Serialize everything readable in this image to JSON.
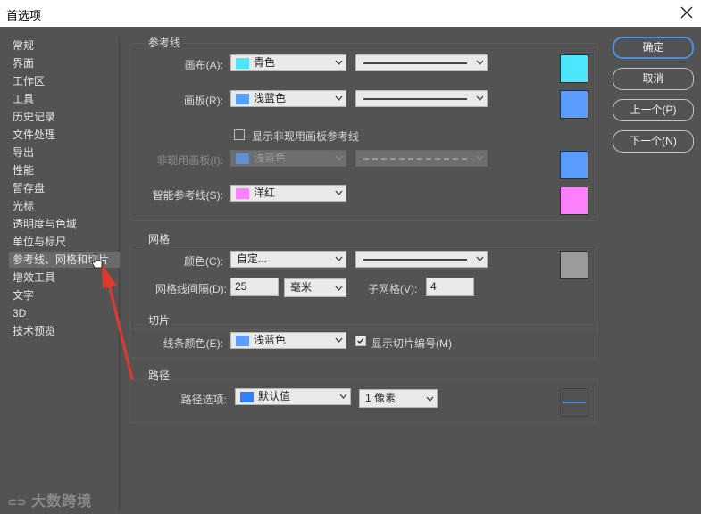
{
  "window": {
    "title": "首选项"
  },
  "sidebar": {
    "items": [
      {
        "label": "常规"
      },
      {
        "label": "界面"
      },
      {
        "label": "工作区"
      },
      {
        "label": "工具"
      },
      {
        "label": "历史记录"
      },
      {
        "label": "文件处理"
      },
      {
        "label": "导出"
      },
      {
        "label": "性能"
      },
      {
        "label": "暂存盘"
      },
      {
        "label": "光标"
      },
      {
        "label": "透明度与色域"
      },
      {
        "label": "单位与标尺"
      },
      {
        "label": "参考线、网格和切片"
      },
      {
        "label": "增效工具"
      },
      {
        "label": "文字"
      },
      {
        "label": "3D"
      },
      {
        "label": "技术预览"
      }
    ],
    "selected_index": 12
  },
  "guides": {
    "title": "参考线",
    "canvas": {
      "label": "画布(A):",
      "color_name": "青色",
      "swatch": "#4ee6ff"
    },
    "artboard": {
      "label": "画板(R):",
      "color_name": "浅蓝色",
      "swatch": "#5a9cff"
    },
    "show_inactive": {
      "label": "显示非现用画板参考线",
      "checked": false
    },
    "inactive_artboard": {
      "label": "非现用画板(I):",
      "color_name": "浅蓝色",
      "swatch": "#5a9cff"
    },
    "smart_guides": {
      "label": "智能参考线(S):",
      "color_name": "洋红",
      "swatch": "#ff80ff"
    }
  },
  "grid": {
    "title": "网格",
    "color": {
      "label": "颜色(C):",
      "value": "自定...",
      "swatch": "#9b9b9b"
    },
    "gridline_every": {
      "label": "网格线间隔(D):",
      "value": "25",
      "unit": "毫米"
    },
    "subdivisions": {
      "label": "子网格(V):",
      "value": "4"
    }
  },
  "slices": {
    "title": "切片",
    "line_color": {
      "label": "线条颜色(E):",
      "color_name": "浅蓝色",
      "swatch": "#5a9cff"
    },
    "show_numbers": {
      "label": "显示切片编号(M)",
      "checked": true
    }
  },
  "path": {
    "title": "路径",
    "options": {
      "label": "路径选项:",
      "color_name": "默认值",
      "swatch": "#2f80ff"
    },
    "width": {
      "value": "1 像素"
    },
    "preview_color": "#4a8fe3"
  },
  "buttons": {
    "ok": "确定",
    "cancel": "取消",
    "prev": "上一个(P)",
    "next": "下一个(N)"
  },
  "watermark": {
    "text": "大数跨境"
  },
  "colors": {
    "accent": "#4a8fe3",
    "annotation_arrow": "#e03a2f"
  }
}
